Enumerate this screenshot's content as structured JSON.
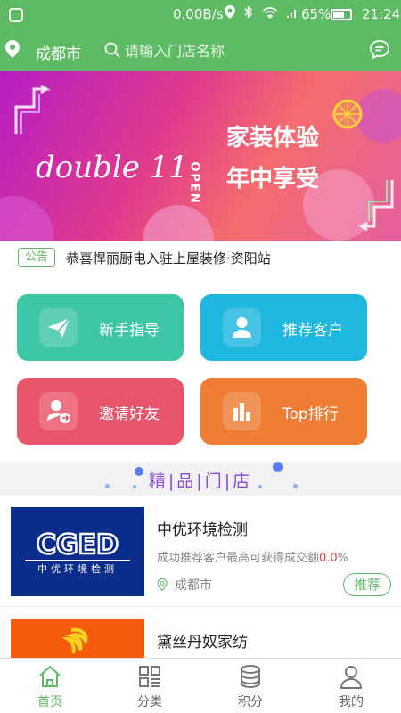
{
  "status_bar": {
    "speed": "0.00B/s",
    "battery": "65%",
    "time": "21:24"
  },
  "header": {
    "city": "成都市",
    "search_placeholder": "请输入门店名称"
  },
  "banner": {
    "script_text": "double 11",
    "side_text": "OPEN",
    "headline_1": "家装体验",
    "headline_2": "年中享受"
  },
  "notice": {
    "badge": "公告",
    "text": "恭喜悍丽厨电入驻上屋装修·资阳站"
  },
  "actions": [
    {
      "label": "新手指导",
      "icon": "paper-plane-icon",
      "color": "#3cc6a6"
    },
    {
      "label": "推荐客户",
      "icon": "user-icon",
      "color": "#1fb7e0"
    },
    {
      "label": "邀请好友",
      "icon": "invite-user-icon",
      "color": "#e9556a"
    },
    {
      "label": "Top排行",
      "icon": "bar-chart-icon",
      "color": "#ef7d34"
    }
  ],
  "section": {
    "title": "精|品|门|店"
  },
  "stores": [
    {
      "logo_text": "CGED",
      "logo_sub": "中优环境检测",
      "name": "中优环境检测",
      "desc": "成功推荐客户最高可获得成交额",
      "percent": "0.0",
      "percent_sign": "%",
      "city": "成都市",
      "button": "推荐"
    },
    {
      "name": "黛丝丹奴家纺"
    }
  ],
  "nav": [
    {
      "label": "首页",
      "icon": "home-icon",
      "active": true
    },
    {
      "label": "分类",
      "icon": "category-icon",
      "active": false
    },
    {
      "label": "积分",
      "icon": "coins-icon",
      "active": false
    },
    {
      "label": "我的",
      "icon": "profile-icon",
      "active": false
    }
  ],
  "colors": {
    "primary": "#5dbb63",
    "section_title": "#8a4ae0",
    "percent": "#e33a3a"
  }
}
